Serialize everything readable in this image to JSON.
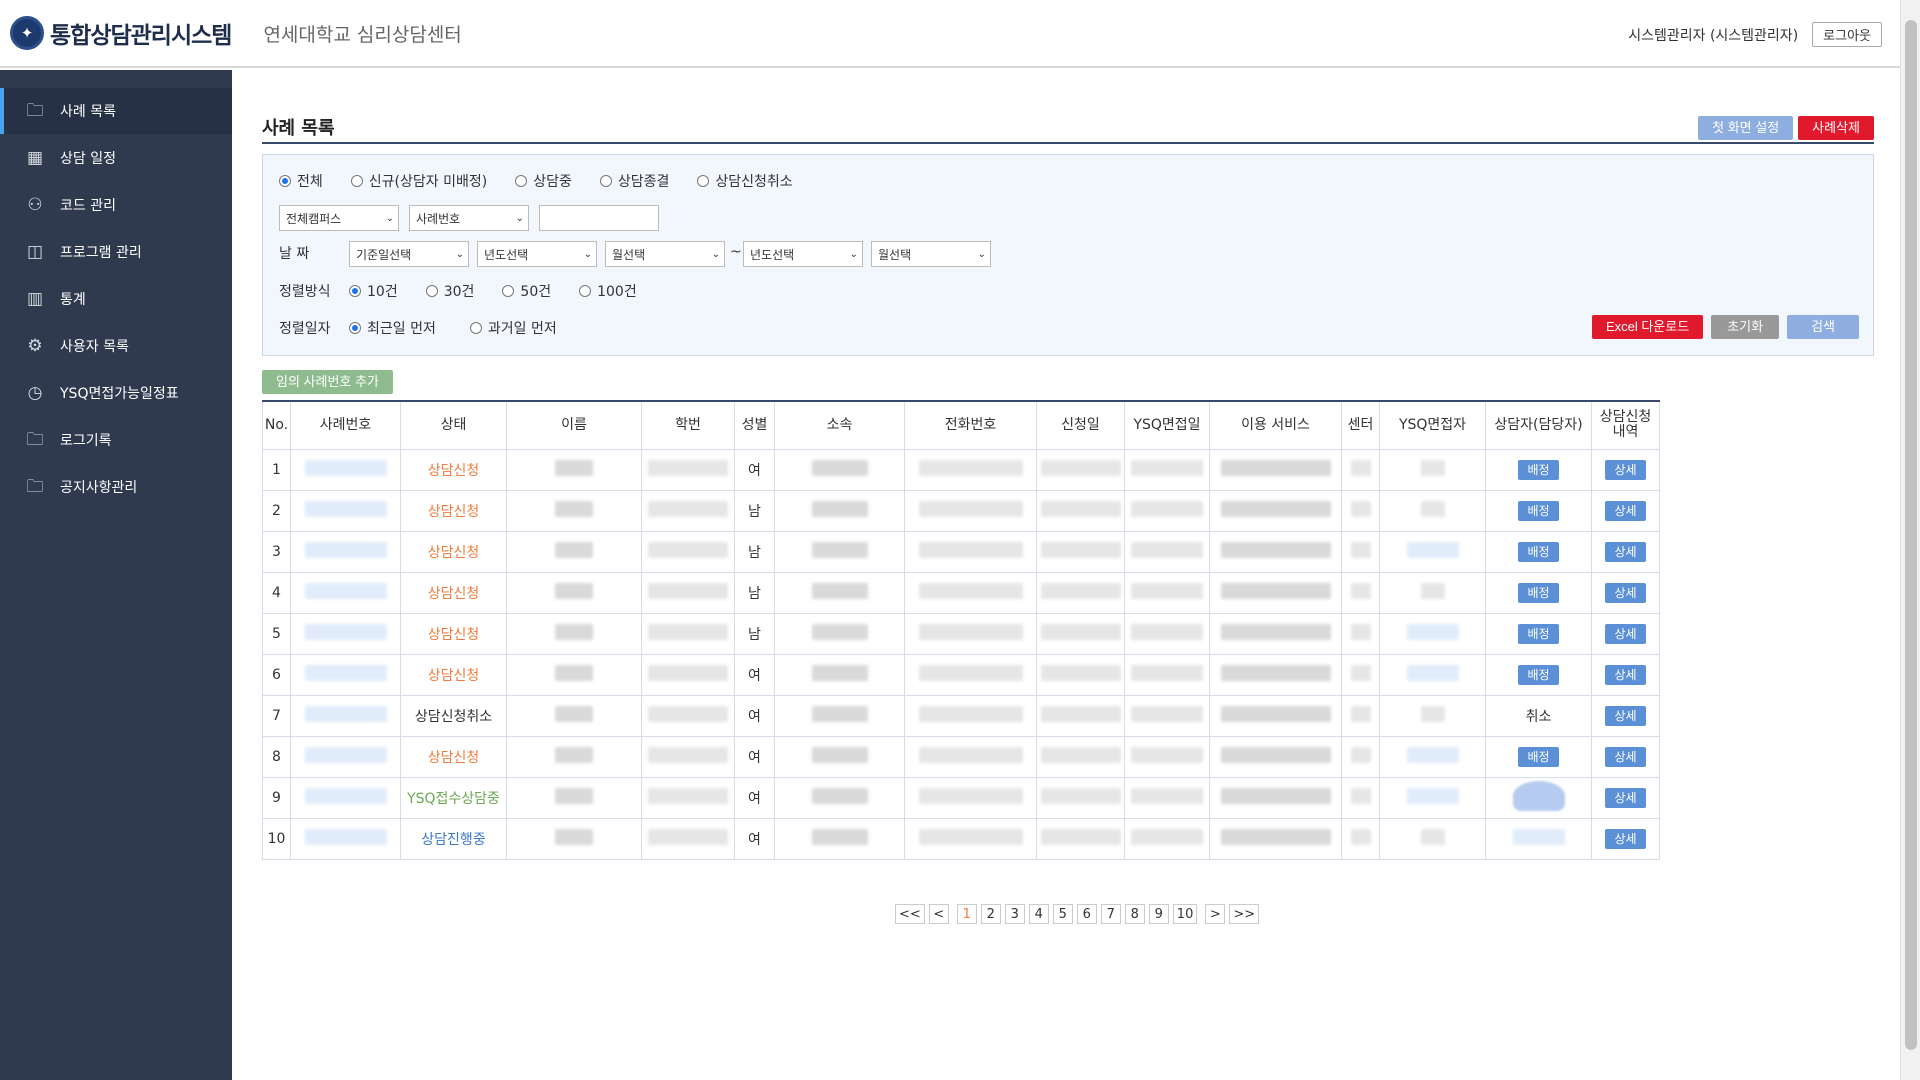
{
  "header": {
    "logo_icon": "university-emblem-icon",
    "system_title": "통합상담관리시스템",
    "center_name": "연세대학교 심리상담센터",
    "user": "시스템관리자 (시스템관리자)",
    "logout_label": "로그아웃"
  },
  "sidebar": {
    "items": [
      {
        "label": "사례 목록",
        "icon": "folder-icon",
        "active": true
      },
      {
        "label": "상담 일정",
        "icon": "calendar-icon"
      },
      {
        "label": "코드 관리",
        "icon": "users-icon"
      },
      {
        "label": "프로그램 관리",
        "icon": "chart-board-icon"
      },
      {
        "label": "통계",
        "icon": "bar-chart-icon"
      },
      {
        "label": "사용자 목록",
        "icon": "gear-icon"
      },
      {
        "label": "YSQ면접가능일정표",
        "icon": "clock-icon"
      },
      {
        "label": "로그기록",
        "icon": "folder-icon"
      },
      {
        "label": "공지사항관리",
        "icon": "folder-icon"
      }
    ]
  },
  "page": {
    "title": "사례 목록",
    "home_setting_label": "첫 화면 설정",
    "delete_label": "사례삭제"
  },
  "filters": {
    "status_options": [
      "전체",
      "신규(상담자 미배정)",
      "상담중",
      "상담종결",
      "상담신청취소"
    ],
    "status_selected": 0,
    "campus_select": "전체캠퍼스",
    "field_select": "사례번호",
    "search_value": "",
    "date_label": "날 짜",
    "date_basis_select": "기준일선택",
    "year_from": "년도선택",
    "month_from": "월선택",
    "tilde": "~",
    "year_to": "년도선택",
    "month_to": "월선택",
    "sort_count_label": "정렬방식",
    "sort_count_options": [
      "10건",
      "30건",
      "50건",
      "100건"
    ],
    "sort_count_selected": 0,
    "sort_date_label": "정렬일자",
    "sort_date_options": [
      "최근일 먼저",
      "과거일 먼저"
    ],
    "sort_date_selected": 0,
    "excel_label": "Excel 다운로드",
    "reset_label": "초기화",
    "search_label": "검색"
  },
  "add_case_label": "임의 사례번호 추가",
  "table": {
    "headers": [
      "No.",
      "사례번호",
      "상태",
      "이름",
      "학번",
      "성별",
      "소속",
      "전화번호",
      "신청일",
      "YSQ면접일",
      "이용 서비스",
      "센터",
      "YSQ면접자",
      "상담자(담당자)",
      "상담신청\n내역"
    ],
    "rows": [
      {
        "no": "1",
        "status": "상담신청",
        "status_type": "orange",
        "gender": "여",
        "counselor": "배정",
        "detail": "상세"
      },
      {
        "no": "2",
        "status": "상담신청",
        "status_type": "orange",
        "gender": "남",
        "counselor": "배정",
        "detail": "상세"
      },
      {
        "no": "3",
        "status": "상담신청",
        "status_type": "orange",
        "gender": "남",
        "counselor": "배정",
        "detail": "상세"
      },
      {
        "no": "4",
        "status": "상담신청",
        "status_type": "orange",
        "gender": "남",
        "counselor": "배정",
        "detail": "상세"
      },
      {
        "no": "5",
        "status": "상담신청",
        "status_type": "orange",
        "gender": "남",
        "counselor": "배정",
        "detail": "상세"
      },
      {
        "no": "6",
        "status": "상담신청",
        "status_type": "orange",
        "gender": "여",
        "counselor": "배정",
        "detail": "상세"
      },
      {
        "no": "7",
        "status": "상담신청취소",
        "status_type": "normal",
        "gender": "여",
        "counselor": "취소",
        "detail": "상세"
      },
      {
        "no": "8",
        "status": "상담신청",
        "status_type": "orange",
        "gender": "여",
        "counselor": "배정",
        "detail": "상세"
      },
      {
        "no": "9",
        "status": "YSQ접수상담중",
        "status_type": "green",
        "gender": "여",
        "counselor": "",
        "detail": "상세"
      },
      {
        "no": "10",
        "status": "상담진행중",
        "status_type": "blue",
        "gender": "여",
        "counselor": "",
        "detail": "상세"
      }
    ]
  },
  "pagination": {
    "first": "<<",
    "prev": "<",
    "pages": [
      "1",
      "2",
      "3",
      "4",
      "5",
      "6",
      "7",
      "8",
      "9",
      "10"
    ],
    "current": "1",
    "next": ">",
    "last": ">>"
  }
}
